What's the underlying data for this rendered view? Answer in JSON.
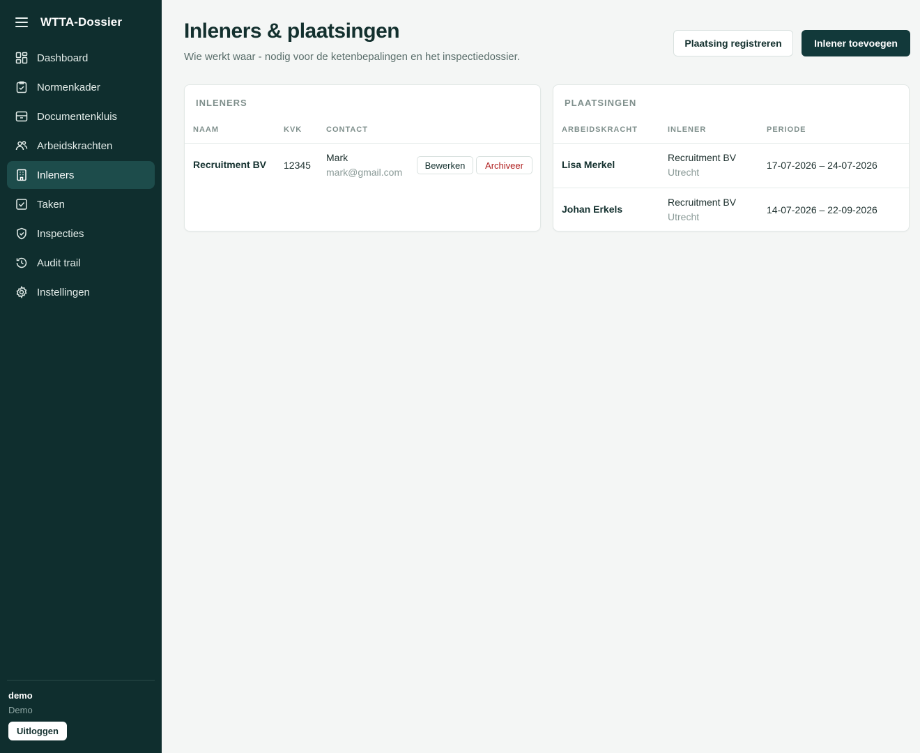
{
  "app": {
    "name": "WTTA-Dossier"
  },
  "sidebar": {
    "items": [
      {
        "label": "Dashboard",
        "icon": "dashboard-icon"
      },
      {
        "label": "Normenkader",
        "icon": "clipboard-check-icon"
      },
      {
        "label": "Documentenkluis",
        "icon": "archive-box-icon"
      },
      {
        "label": "Arbeidskrachten",
        "icon": "users-icon"
      },
      {
        "label": "Inleners",
        "icon": "building-icon",
        "active": true
      },
      {
        "label": "Taken",
        "icon": "checkbox-icon"
      },
      {
        "label": "Inspecties",
        "icon": "shield-check-icon"
      },
      {
        "label": "Audit trail",
        "icon": "history-icon"
      },
      {
        "label": "Instellingen",
        "icon": "gear-icon"
      }
    ],
    "user": {
      "name": "demo",
      "org": "Demo",
      "logout_label": "Uitloggen"
    }
  },
  "header": {
    "title": "Inleners & plaatsingen",
    "subtitle": "Wie werkt waar - nodig voor de ketenbepalingen en het inspectiedossier.",
    "secondary_button": "Plaatsing registreren",
    "primary_button": "Inlener toevoegen"
  },
  "inleners": {
    "title": "INLENERS",
    "columns": [
      "NAAM",
      "KVK",
      "CONTACT"
    ],
    "rows": [
      {
        "naam": "Recruitment BV",
        "kvk": "12345",
        "contact_name": "Mark",
        "contact_email": "mark@gmail.com",
        "edit_label": "Bewerken",
        "archive_label": "Archiveer"
      }
    ]
  },
  "plaatsingen": {
    "title": "PLAATSINGEN",
    "columns": [
      "ARBEIDSKRACHT",
      "INLENER",
      "PERIODE"
    ],
    "rows": [
      {
        "arbeidskracht": "Lisa Merkel",
        "inlener": "Recruitment BV",
        "locatie": "Utrecht",
        "periode": "17-07-2026 – 24-07-2026"
      },
      {
        "arbeidskracht": "Johan Erkels",
        "inlener": "Recruitment BV",
        "locatie": "Utrecht",
        "periode": "14-07-2026 – 22-09-2026"
      }
    ]
  },
  "colors": {
    "sidebar_bg": "#0f2e2e",
    "active_item_bg": "#1d4c4b",
    "primary_button_bg": "#12393a",
    "archive_text": "#b02020"
  }
}
